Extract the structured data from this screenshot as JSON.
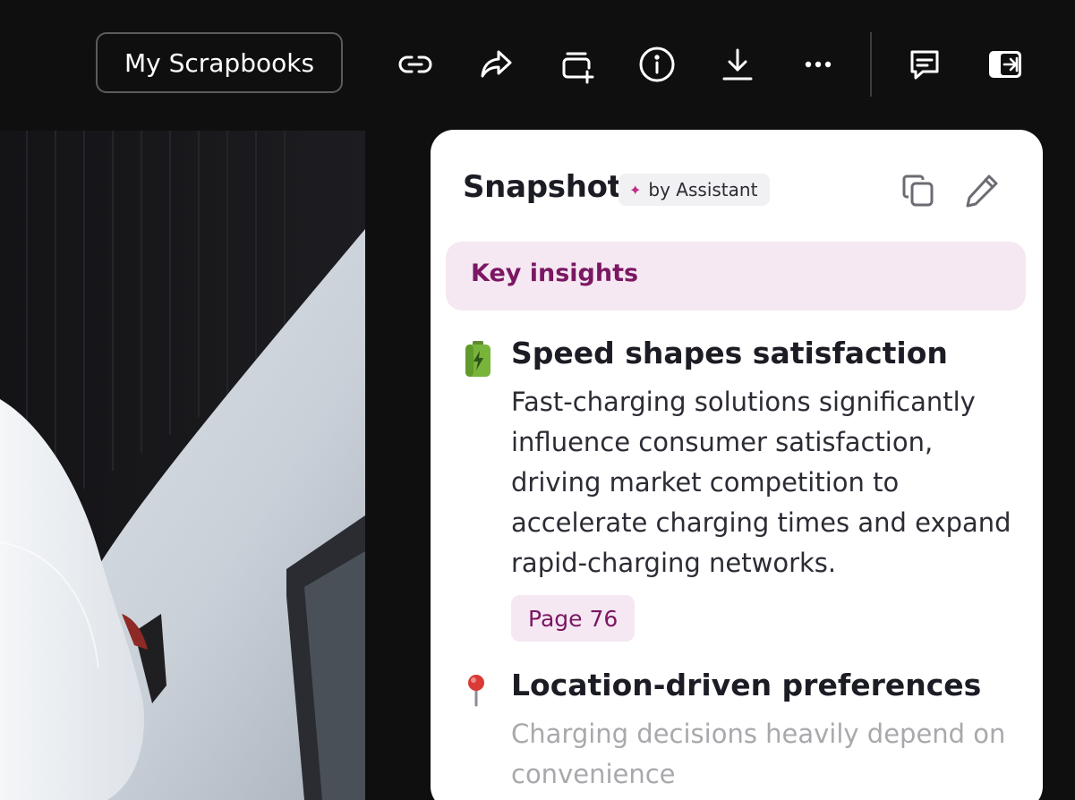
{
  "toolbar": {
    "scrapbooks_label": "My Scrapbooks",
    "icons": [
      "link-icon",
      "share-icon",
      "add-to-collection-icon",
      "info-icon",
      "download-icon",
      "more-icon",
      "comment-icon",
      "close-panel-icon"
    ]
  },
  "panel": {
    "title": "Snapshot",
    "badge_label": "by Assistant",
    "section_label": "Key insights",
    "insights": [
      {
        "icon": "battery-icon",
        "title": "Speed shapes satisfaction",
        "body": "Fast-charging solutions significantly influence consumer satisfaction, driving market competition to accelerate charging times and expand rapid-charging networks.",
        "page_label": "Page 76"
      },
      {
        "icon": "pin-icon",
        "title": "Location-driven preferences",
        "body": "Charging decisions heavily depend on convenience"
      }
    ]
  },
  "colors": {
    "accent": "#7b1763",
    "accent_bg": "#f5e8f2",
    "background": "#0f0f10"
  }
}
